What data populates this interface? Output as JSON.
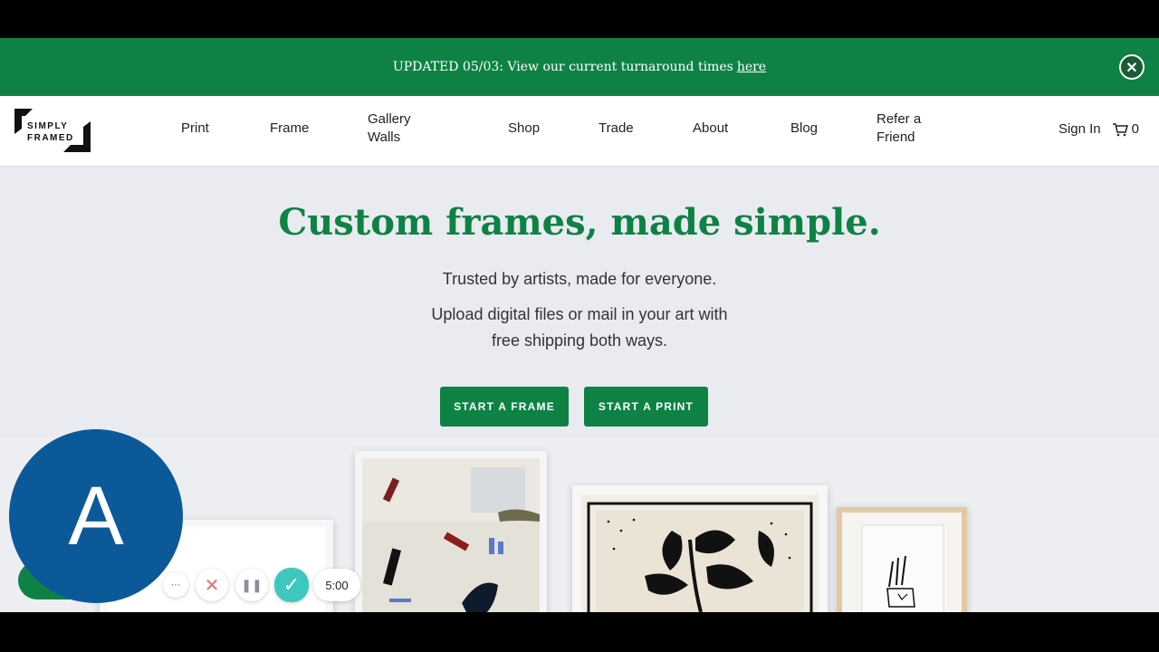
{
  "banner": {
    "text": "UPDATED 05/03: View our current turnaround times",
    "link": "here",
    "close_glyph": "✕"
  },
  "logo": {
    "line1": "SIMPLY",
    "line2": "FRAMED"
  },
  "nav": {
    "items": [
      {
        "label": "Print"
      },
      {
        "label": "Frame"
      },
      {
        "label": "Gallery Walls"
      },
      {
        "label": "Shop"
      },
      {
        "label": "Trade"
      },
      {
        "label": "About"
      },
      {
        "label": "Blog"
      },
      {
        "label": "Refer a Friend"
      }
    ],
    "sign_in": "Sign In",
    "cart_count": "0"
  },
  "hero": {
    "title": "Custom frames, made simple.",
    "line1": "Trusted by artists, made for everyone.",
    "line2": "Upload digital files or mail in your art with",
    "line3": "free shipping both ways.",
    "cta_frame": "START A FRAME",
    "cta_print": "START A PRINT"
  },
  "recorder": {
    "avatar_letter": "A",
    "more_glyph": "···",
    "cancel_glyph": "✕",
    "pause_glyph": "❚❚",
    "done_glyph": "✓",
    "timer": "5:00"
  },
  "colors": {
    "brand_green": "#0d8244",
    "avatar_blue": "#0b5999",
    "teal": "#3ec7bf",
    "cancel_red": "#e86f6f"
  }
}
